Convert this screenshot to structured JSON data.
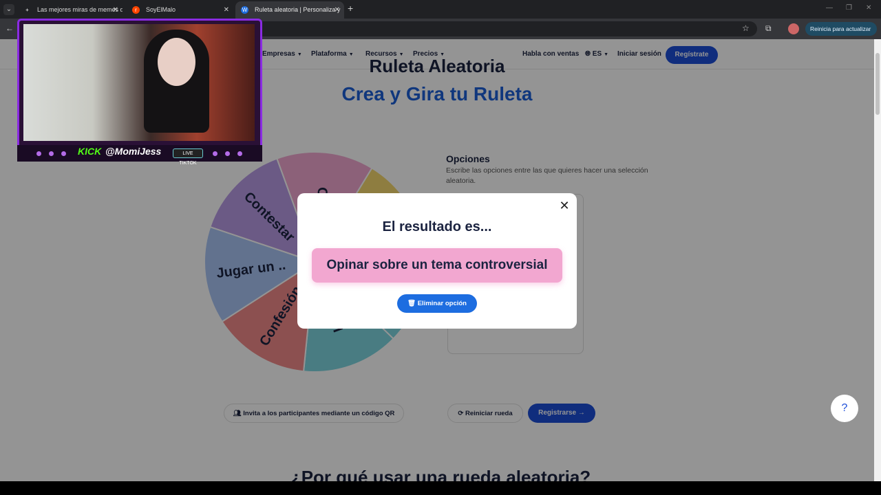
{
  "browser": {
    "tabs": [
      {
        "label": "Las mejores miras de memes d",
        "favicon": "+"
      },
      {
        "label": "SoyElMalo",
        "favicon": "r"
      },
      {
        "label": "Ruleta aleatoria | Personaliza y",
        "favicon": "W"
      }
    ],
    "update_label": "Reinicia para actualizar",
    "new_tab": "+",
    "close_glyph": "✕",
    "menu_glyph": "⌄"
  },
  "nav": {
    "items": [
      "Empresas",
      "Plataforma",
      "Recursos",
      "Precios"
    ],
    "sales": "Habla con ventas",
    "lang": "ES",
    "login": "Iniciar sesión",
    "register": "Regístrate"
  },
  "hero": {
    "title_top": "Ruleta Aleatoria",
    "title": "Crea y Gira tu Ruleta"
  },
  "wheel": {
    "segments": [
      {
        "label": "Opinar sobre un tema controversial",
        "display": "Opi",
        "color": "#f2a7d0"
      },
      {
        "label": "",
        "display": "",
        "color": "#f5d76e"
      },
      {
        "label": "",
        "display": "",
        "color": "#7ed6e0"
      },
      {
        "label": "Llamar",
        "display": "Lla",
        "color": "#7ed6e0"
      },
      {
        "label": "Confesión",
        "display": "Confesión",
        "color": "#f28b8b"
      },
      {
        "label": "Jugar un ..",
        "display": "Jugar un ..",
        "color": "#a9c4f5"
      },
      {
        "label": "Contestar",
        "display": "Contestar",
        "color": "#b99be6"
      }
    ]
  },
  "options": {
    "title": "Opciones",
    "description": "Escribe las opciones entre las que quieres hacer una selección aleatoria."
  },
  "actions": {
    "invite": "Invita a los participantes mediante un código QR",
    "reset": "Reiniciar rueda",
    "register": "Registrarse"
  },
  "section_heading": "¿Por qué usar una rueda aleatoria?",
  "help": "?",
  "modal": {
    "title": "El resultado es...",
    "result": "Opinar sobre un tema controversial",
    "delete": "Eliminar opción",
    "close": "✕"
  },
  "stream": {
    "kick": "KICK",
    "handle": "@MomiJess",
    "tiktok": "LIVE TIKTOK"
  },
  "colors": {
    "brand_blue": "#1d4ed8",
    "title_blue": "#1d5fd8",
    "result_pink": "#f2a7d0",
    "overlay_purple": "#8a2be2"
  }
}
